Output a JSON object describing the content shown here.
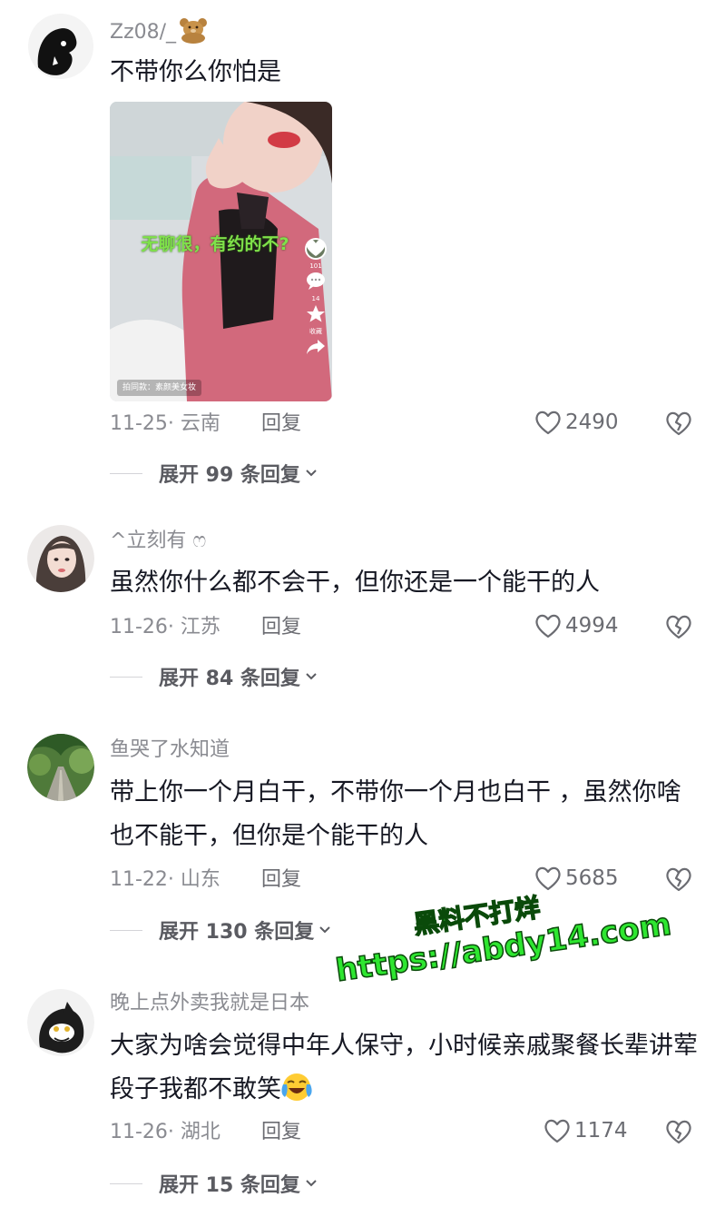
{
  "comments": [
    {
      "username": "Zz08/_",
      "text": "不带你么你怕是",
      "video": {
        "caption": "无聊很，有约的不?",
        "badge": "拍同款：素颜美女妆",
        "likes": "101",
        "comments": "14",
        "collect": "收藏"
      },
      "date": "11-25· 云南",
      "reply": "回复",
      "likes": "2490",
      "expand": "展开 99 条回复"
    },
    {
      "username": "^立刻有 ෆ︎",
      "text": "虽然你什么都不会干，但你还是一个能干的人",
      "date": "11-26· 江苏",
      "reply": "回复",
      "likes": "4994",
      "expand": "展开 84 条回复"
    },
    {
      "username": "鱼哭了水知道",
      "text": "带上你一个月白干，不带你一个月也白干 ，虽然你啥也不能干，但你是个能干的人",
      "date": "11-22· 山东",
      "reply": "回复",
      "likes": "5685",
      "expand": "展开 130 条回复"
    },
    {
      "username": "晚上点外卖我就是日本",
      "text": "大家为啥会觉得中年人保守，小时候亲戚聚餐长辈讲荤段子我都不敢笑",
      "date": "11-26· 湖北",
      "reply": "回复",
      "likes": "1174",
      "expand": "展开 15 条回复"
    }
  ],
  "watermark": {
    "line1": "黑料不打烊",
    "line2": "https://abdy14.com"
  },
  "colors": {
    "text": "#161823",
    "meta": "#8a8b91",
    "watermark": "#2ee630"
  }
}
